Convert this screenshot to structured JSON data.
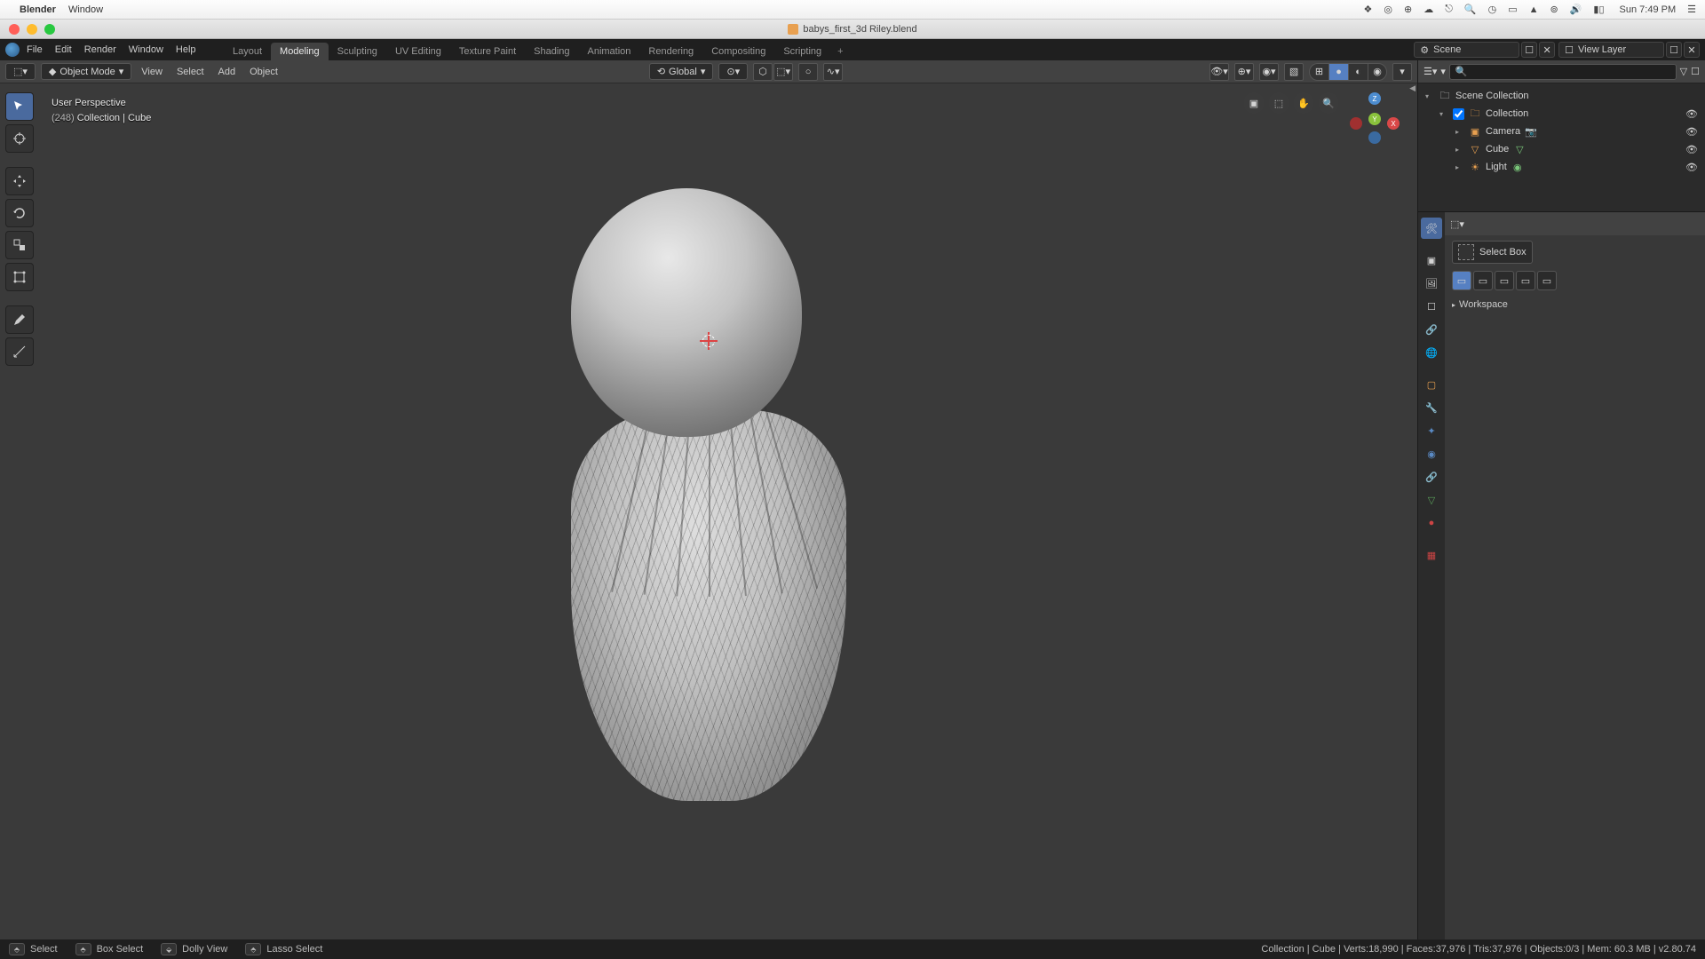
{
  "mac_menu": {
    "app": "Blender",
    "items": [
      "Window"
    ],
    "clock": "Sun 7:49 PM"
  },
  "titlebar": {
    "filename": "babys_first_3d Riley.blend"
  },
  "blender_menu": {
    "items": [
      "File",
      "Edit",
      "Render",
      "Window",
      "Help"
    ]
  },
  "workspace_tabs": [
    "Layout",
    "Modeling",
    "Sculpting",
    "UV Editing",
    "Texture Paint",
    "Shading",
    "Animation",
    "Rendering",
    "Compositing",
    "Scripting"
  ],
  "workspace_active": "Modeling",
  "scene_selector": {
    "label": "Scene"
  },
  "layer_selector": {
    "label": "View Layer"
  },
  "vp_header": {
    "mode": "Object Mode",
    "menus": [
      "View",
      "Select",
      "Add",
      "Object"
    ],
    "orientation": "Global"
  },
  "vp_overlay": {
    "persp": "User Perspective",
    "frame_label": "(248)",
    "context": "Collection | Cube"
  },
  "outliner": {
    "root": "Scene Collection",
    "collection": "Collection",
    "items": [
      {
        "name": "Camera",
        "icon": "camera"
      },
      {
        "name": "Cube",
        "icon": "mesh"
      },
      {
        "name": "Light",
        "icon": "light"
      }
    ]
  },
  "properties": {
    "active_tool": "Select Box",
    "workspace_label": "Workspace"
  },
  "status": {
    "shortcuts": [
      {
        "icon": "L",
        "label": "Select"
      },
      {
        "icon": "L",
        "label": "Box Select"
      },
      {
        "icon": "M",
        "label": "Dolly View"
      },
      {
        "icon": "L",
        "label": "Lasso Select"
      }
    ],
    "info": "Collection | Cube | Verts:18,990 | Faces:37,976 | Tris:37,976 | Objects:0/3 | Mem: 60.3 MB | v2.80.74"
  }
}
